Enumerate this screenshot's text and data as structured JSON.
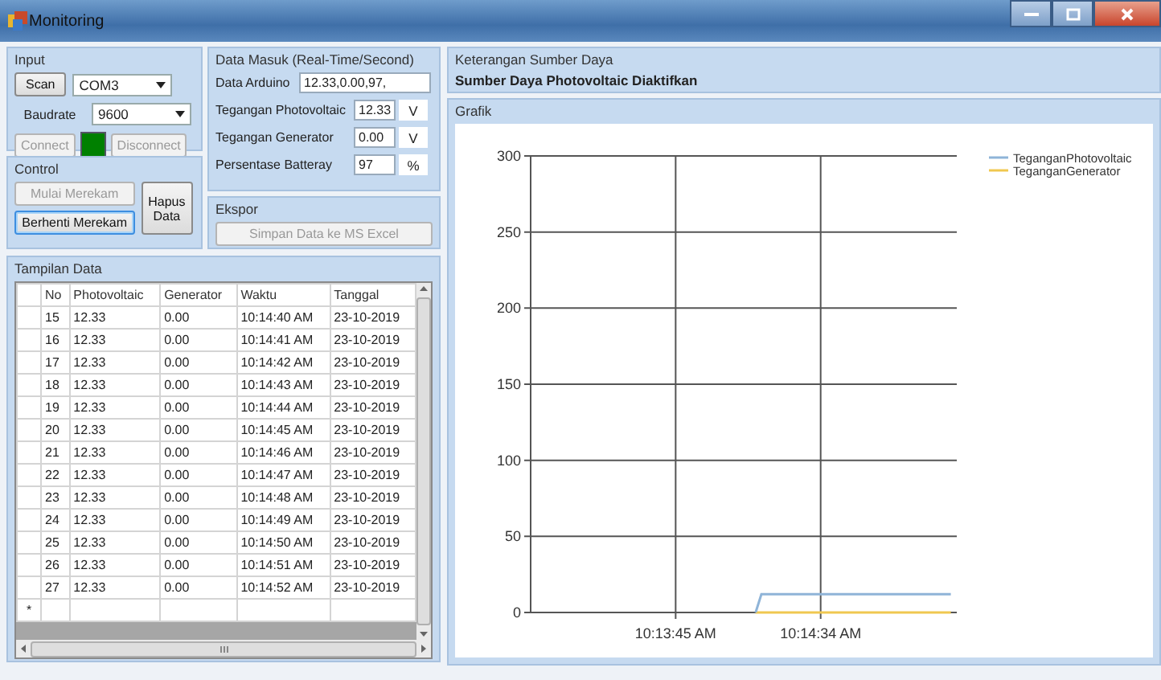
{
  "window": {
    "title": "Monitoring"
  },
  "input": {
    "title": "Input",
    "scan_button": "Scan",
    "port": "COM3",
    "baudrate_label": "Baudrate",
    "baudrate": "9600",
    "connect": {
      "label": "Connect",
      "disabled": true
    },
    "connected": true,
    "disconnect": {
      "label": "Disconnect",
      "disabled": true
    }
  },
  "control": {
    "title": "Control",
    "buttons": [
      {
        "label": "Mulai Merekam",
        "disabled": true,
        "focused": false
      },
      {
        "label": "Berhenti Merekam",
        "disabled": false,
        "focused": true
      },
      {
        "label": "Hapus Data",
        "disabled": false,
        "focused": false
      }
    ]
  },
  "data_masuk": {
    "title": "Data Masuk (Real-Time/Second)",
    "fields": [
      {
        "label": "Data Arduino",
        "value": "12.33,0.00,97,"
      },
      {
        "label": "Tegangan Photovoltaic",
        "value": "12.33",
        "unit": "V"
      },
      {
        "label": "Tegangan Generator",
        "value": "0.00",
        "unit": "V"
      },
      {
        "label": "Persentase Batteray",
        "value": "97",
        "unit": "%"
      }
    ]
  },
  "ekspor": {
    "title": "Ekspor",
    "button": {
      "label": "Simpan Data ke MS Excel",
      "disabled": true
    }
  },
  "tampilan_data": {
    "title": "Tampilan Data",
    "columns": [
      "No",
      "Photovoltaic",
      "Generator",
      "Waktu",
      "Tanggal"
    ],
    "rows": [
      [
        "15",
        "12.33",
        "0.00",
        "10:14:40 AM",
        "23-10-2019"
      ],
      [
        "16",
        "12.33",
        "0.00",
        "10:14:41 AM",
        "23-10-2019"
      ],
      [
        "17",
        "12.33",
        "0.00",
        "10:14:42 AM",
        "23-10-2019"
      ],
      [
        "18",
        "12.33",
        "0.00",
        "10:14:43 AM",
        "23-10-2019"
      ],
      [
        "19",
        "12.33",
        "0.00",
        "10:14:44 AM",
        "23-10-2019"
      ],
      [
        "20",
        "12.33",
        "0.00",
        "10:14:45 AM",
        "23-10-2019"
      ],
      [
        "21",
        "12.33",
        "0.00",
        "10:14:46 AM",
        "23-10-2019"
      ],
      [
        "22",
        "12.33",
        "0.00",
        "10:14:47 AM",
        "23-10-2019"
      ],
      [
        "23",
        "12.33",
        "0.00",
        "10:14:48 AM",
        "23-10-2019"
      ],
      [
        "24",
        "12.33",
        "0.00",
        "10:14:49 AM",
        "23-10-2019"
      ],
      [
        "25",
        "12.33",
        "0.00",
        "10:14:50 AM",
        "23-10-2019"
      ],
      [
        "26",
        "12.33",
        "0.00",
        "10:14:51 AM",
        "23-10-2019"
      ],
      [
        "27",
        "12.33",
        "0.00",
        "10:14:52 AM",
        "23-10-2019"
      ]
    ],
    "new_row_marker": "*"
  },
  "keterangan": {
    "title": "Keterangan Sumber Daya",
    "text": "Sumber Daya Photovoltaic Diaktifkan"
  },
  "grafik": {
    "title": "Grafik",
    "chart_data": {
      "type": "line",
      "grid": true,
      "legend": "top-right",
      "x": [
        36852,
        36854,
        36918
      ],
      "xlim": [
        36776,
        36920
      ],
      "ylim": [
        0,
        300
      ],
      "xticks": [
        {
          "value": 36825,
          "label": "10:13:45 AM"
        },
        {
          "value": 36874,
          "label": "10:14:34 AM"
        }
      ],
      "yticks": [
        0,
        50,
        100,
        150,
        200,
        250,
        300
      ],
      "series": [
        {
          "name": "TeganganPhotovoltaic",
          "color": "#8fb4d8",
          "values": [
            0,
            12,
            12
          ]
        },
        {
          "name": "TeganganGenerator",
          "color": "#f0c850",
          "values": [
            0,
            0,
            0
          ]
        }
      ]
    }
  }
}
